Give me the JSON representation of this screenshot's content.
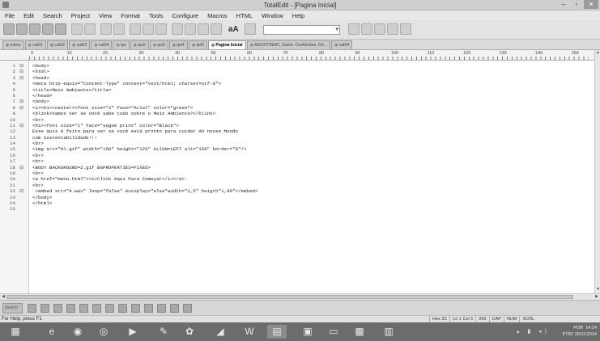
{
  "window": {
    "title": "TotalEdit - [Pagina Inicial]",
    "controls": [
      "–",
      "▫",
      "✕"
    ]
  },
  "menubar": [
    "File",
    "Edit",
    "Search",
    "Project",
    "View",
    "Format",
    "Tools",
    "Configure",
    "Macros",
    "HTML",
    "Window",
    "Help"
  ],
  "toolbar": {
    "font_icon_label": "aA",
    "combo_value": ""
  },
  "tabs": [
    {
      "label": "menu"
    },
    {
      "label": "cat01"
    },
    {
      "label": "cat02"
    },
    {
      "label": "cat03"
    },
    {
      "label": "cat04"
    },
    {
      "label": "qsi"
    },
    {
      "label": "qsi2"
    },
    {
      "label": "qsi3"
    },
    {
      "label": "qsi4"
    },
    {
      "label": "qsi5"
    },
    {
      "label": "Pagina Inicial",
      "active": true
    },
    {
      "label": "AGOSTINHO, Santo. Confissões. De..."
    },
    {
      "label": "cat04"
    }
  ],
  "ruler": {
    "labels": [
      "0",
      "10",
      "20",
      "30",
      "40",
      "50",
      "60",
      "70",
      "80",
      "90",
      "100",
      "110",
      "120",
      "130",
      "140",
      "150"
    ]
  },
  "code": [
    {
      "n": "1",
      "fold": "⊟",
      "text": "<body>"
    },
    {
      "n": "2",
      "fold": "⊟",
      "text": "<html>"
    },
    {
      "n": "3",
      "fold": "⊟",
      "text": "<head>"
    },
    {
      "n": "4",
      "fold": "",
      "text": "<meta http-equiv=\"Content-Type\" content=\"text/html; charset=utf-8\">"
    },
    {
      "n": "5",
      "fold": "",
      "text": "<title>Meio Ambiente</title>"
    },
    {
      "n": "6",
      "fold": "",
      "text": "</head>"
    },
    {
      "n": "7",
      "fold": "⊟",
      "text": "<body>"
    },
    {
      "n": "8",
      "fold": "⊟",
      "text": "<i><h1><center><font size=\"2\" face=\"Arial\" color=\"green\">"
    },
    {
      "n": "9",
      "fold": "",
      "text": "<blink>Vamos ver se você sabe tudo sobre o Meio Ambiente?</blink>"
    },
    {
      "n": "10",
      "fold": "",
      "text": "<br>"
    },
    {
      "n": "11",
      "fold": "⊟",
      "text": "<h1><font size=\"1\" face=\"segoe print\" color=\"Black\">"
    },
    {
      "n": "12",
      "fold": "",
      "text": "Esse quiz é feito para ver se você está pronto para cuidar do nosso Mundo"
    },
    {
      "n": "13",
      "fold": "",
      "text": "com Sustentabilidade!!!"
    },
    {
      "n": "14",
      "fold": "",
      "text": "<br>"
    },
    {
      "n": "15",
      "fold": "",
      "text": "<img src=\"01.gif\" width=\"150\" height=\"125\" ALIGN=LEFT alt=\"156\" border=\"0\"/>"
    },
    {
      "n": "16",
      "fold": "",
      "text": "<br>"
    },
    {
      "n": "17",
      "fold": "",
      "text": "<br>"
    },
    {
      "n": "18",
      "fold": "⊟",
      "text": "<BODY BACKGROUND=2.gif BGPROPERTIES=FIXED>"
    },
    {
      "n": "19",
      "fold": "",
      "text": "<br>"
    },
    {
      "n": "20",
      "fold": "",
      "text": "<a href=\"menu.html\"><i>Click Aqui Para Começar</i></a>."
    },
    {
      "n": "21",
      "fold": "",
      "text": "<br>"
    },
    {
      "n": "22",
      "fold": "⊟",
      "text": " <embed src=\"4.wav\" loop=\"false\" Autoplay=\"else\"width=\"1,5\" heigth\"1,99\"</embed>"
    },
    {
      "n": "23",
      "fold": "",
      "text": "</body>"
    },
    {
      "n": "24",
      "fold": "",
      "text": "</html>"
    },
    {
      "n": "25",
      "fold": "",
      "text": ""
    }
  ],
  "bottom_toolbar": {
    "search_label": "Search"
  },
  "statusbar": {
    "help": "For Help, press F1",
    "panels": [
      "Hex 3C",
      "Ln 1 Col 1",
      "INS",
      "CAP",
      "NUM",
      "SCRL"
    ]
  },
  "taskbar": {
    "items": [
      "start-button",
      "ie-browser",
      "media-player",
      "chrome-browser",
      "media-center",
      "paint",
      "gallery",
      "toolbox",
      "word",
      "totaledit",
      "explorer",
      "folder",
      "images",
      "notepad"
    ],
    "language": "POR",
    "language_sub": "PTB2",
    "time": "14:24",
    "date": "20/11/2014"
  }
}
